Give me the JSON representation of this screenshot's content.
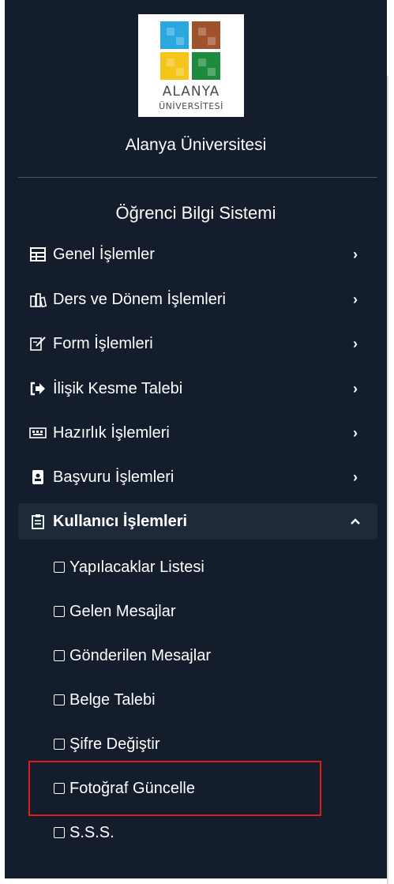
{
  "logo": {
    "line1": "ALANYA",
    "line2": "ÜNİVERSİTESİ"
  },
  "university_name": "Alanya Üniversitesi",
  "system_name": "Öğrenci Bilgi Sistemi",
  "menu": [
    {
      "label": "Genel İşlemler",
      "icon": "grid-icon"
    },
    {
      "label": "Ders ve Dönem İşlemleri",
      "icon": "books-icon"
    },
    {
      "label": "Form İşlemleri",
      "icon": "edit-form-icon"
    },
    {
      "label": "İlişik Kesme Talebi",
      "icon": "sign-out-icon"
    },
    {
      "label": "Hazırlık İşlemleri",
      "icon": "keyboard-icon"
    },
    {
      "label": "Başvuru İşlemleri",
      "icon": "id-badge-icon"
    },
    {
      "label": "Kullanıcı İşlemleri",
      "icon": "clipboard-icon",
      "expanded": true
    }
  ],
  "submenu": [
    {
      "label": "Yapılacaklar Listesi"
    },
    {
      "label": "Gelen Mesajlar"
    },
    {
      "label": "Gönderilen Mesajlar"
    },
    {
      "label": "Belge Talebi"
    },
    {
      "label": "Şifre Değiştir"
    },
    {
      "label": "Fotoğraf Güncelle",
      "highlighted": true
    },
    {
      "label": "S.S.S."
    }
  ],
  "colors": {
    "sidebar_bg": "#131d2b",
    "active_bg": "#1f2a38",
    "highlight_border": "#e01b1b"
  }
}
